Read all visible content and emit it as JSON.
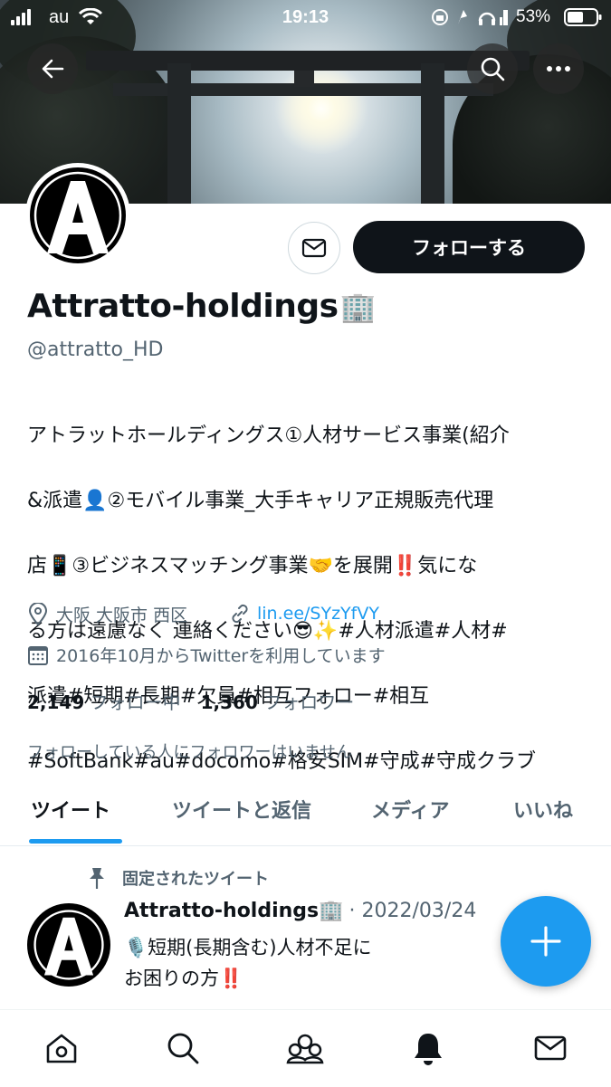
{
  "status_bar": {
    "carrier": "au",
    "time": "19:13",
    "battery": "53%"
  },
  "profile": {
    "name": "Attratto-holdings",
    "name_emoji": "🏢",
    "handle": "@attratto_HD",
    "bio_lines": [
      "アトラットホールディングス①人材サービス事業(紹介",
      "&派遣👤②モバイル事業_大手キャリア正規販売代理",
      "店📱③ビジネスマッチング事業🤝を展開‼️気にな",
      "る方は遠慮なく 連絡ください😎✨#人材派遣#人材#",
      "派遣#短期#長期#欠員#相互フォロー#相互",
      "#SoftBank#au#docomo#格安SIM#守成#守成クラブ"
    ],
    "location": "大阪 大阪市 西区",
    "link": "lin.ee/SYzYfVY",
    "joined": "2016年10月からTwitterを利用しています",
    "following_count": "2,149",
    "following_label": "フォロー中",
    "followers_count": "1,360",
    "followers_label": "フォロワー",
    "no_followers_you_know": "フォローしている人にフォロワーはいません"
  },
  "actions": {
    "follow_label": "フォローする"
  },
  "tabs": [
    {
      "label": "ツイート",
      "active": true
    },
    {
      "label": "ツイートと返信",
      "active": false
    },
    {
      "label": "メディア",
      "active": false
    },
    {
      "label": "いいね",
      "active": false
    }
  ],
  "pinned_tweet": {
    "pinned_label": "固定されたツイート",
    "author": "Attratto-holdings🏢",
    "date": "· 2022/03/24",
    "line1": "🎙️短期(長期含む)人材不足に",
    "line2": "お困りの方‼️"
  },
  "bottom_nav": [
    "home-icon",
    "search-icon",
    "communities-icon",
    "notifications-icon",
    "messages-icon"
  ],
  "colors": {
    "accent": "#1d9bf0",
    "text": "#0f1419",
    "muted": "#536471"
  }
}
